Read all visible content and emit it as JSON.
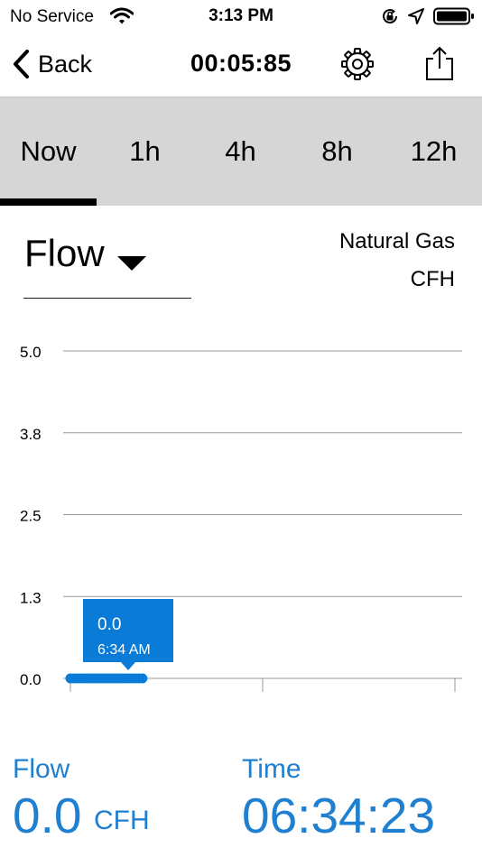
{
  "status_bar": {
    "carrier": "No Service",
    "time": "3:13 PM",
    "icons": [
      "wifi-icon",
      "orientation-lock-icon",
      "location-icon",
      "battery-icon"
    ]
  },
  "nav": {
    "back_label": "Back",
    "timer": "00:05:85",
    "icons": [
      "chevron-left-icon",
      "gear-icon",
      "share-icon"
    ]
  },
  "tabs": [
    {
      "label": "Now",
      "active": true
    },
    {
      "label": "1h",
      "active": false
    },
    {
      "label": "4h",
      "active": false
    },
    {
      "label": "8h",
      "active": false
    },
    {
      "label": "12h",
      "active": false
    }
  ],
  "measurement": {
    "selected": "Flow",
    "gas": "Natural Gas",
    "unit": "CFH"
  },
  "colors": {
    "accent": "#1f7fd0",
    "tooltip": "#0a7bd6",
    "tab_bar": "#d6d6d6"
  },
  "chart_data": {
    "type": "line",
    "yticks": [
      "5.0",
      "3.8",
      "2.5",
      "1.3",
      "0.0"
    ],
    "ylim": [
      0,
      5
    ],
    "series": [
      {
        "values": [
          0,
          0,
          0,
          0,
          0,
          0,
          0,
          0,
          0,
          0,
          0,
          0,
          0,
          0,
          0,
          0,
          0,
          0,
          0,
          0,
          0,
          0
        ]
      }
    ],
    "tooltip": {
      "value": "0.0",
      "time": "6:34 AM"
    },
    "grid": true
  },
  "readout": {
    "flow_caption": "Flow",
    "flow_value": "0.0",
    "flow_unit": "CFH",
    "time_caption": "Time",
    "time_value": "06:34:23"
  }
}
